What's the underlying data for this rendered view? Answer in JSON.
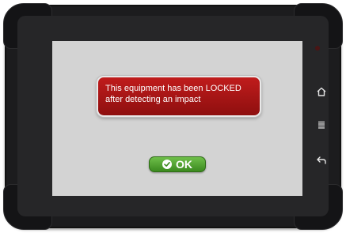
{
  "alert": {
    "line1": "This equipment has been LOCKED",
    "line2": "after detecting an impact",
    "color": "#a81414"
  },
  "ok_button": {
    "label": "OK",
    "icon": "checkmark-circle-icon",
    "color": "#4f9f2a"
  },
  "side_buttons": [
    {
      "icon": "home-icon"
    },
    {
      "icon": "menu-icon"
    },
    {
      "icon": "back-arrow-icon"
    }
  ]
}
